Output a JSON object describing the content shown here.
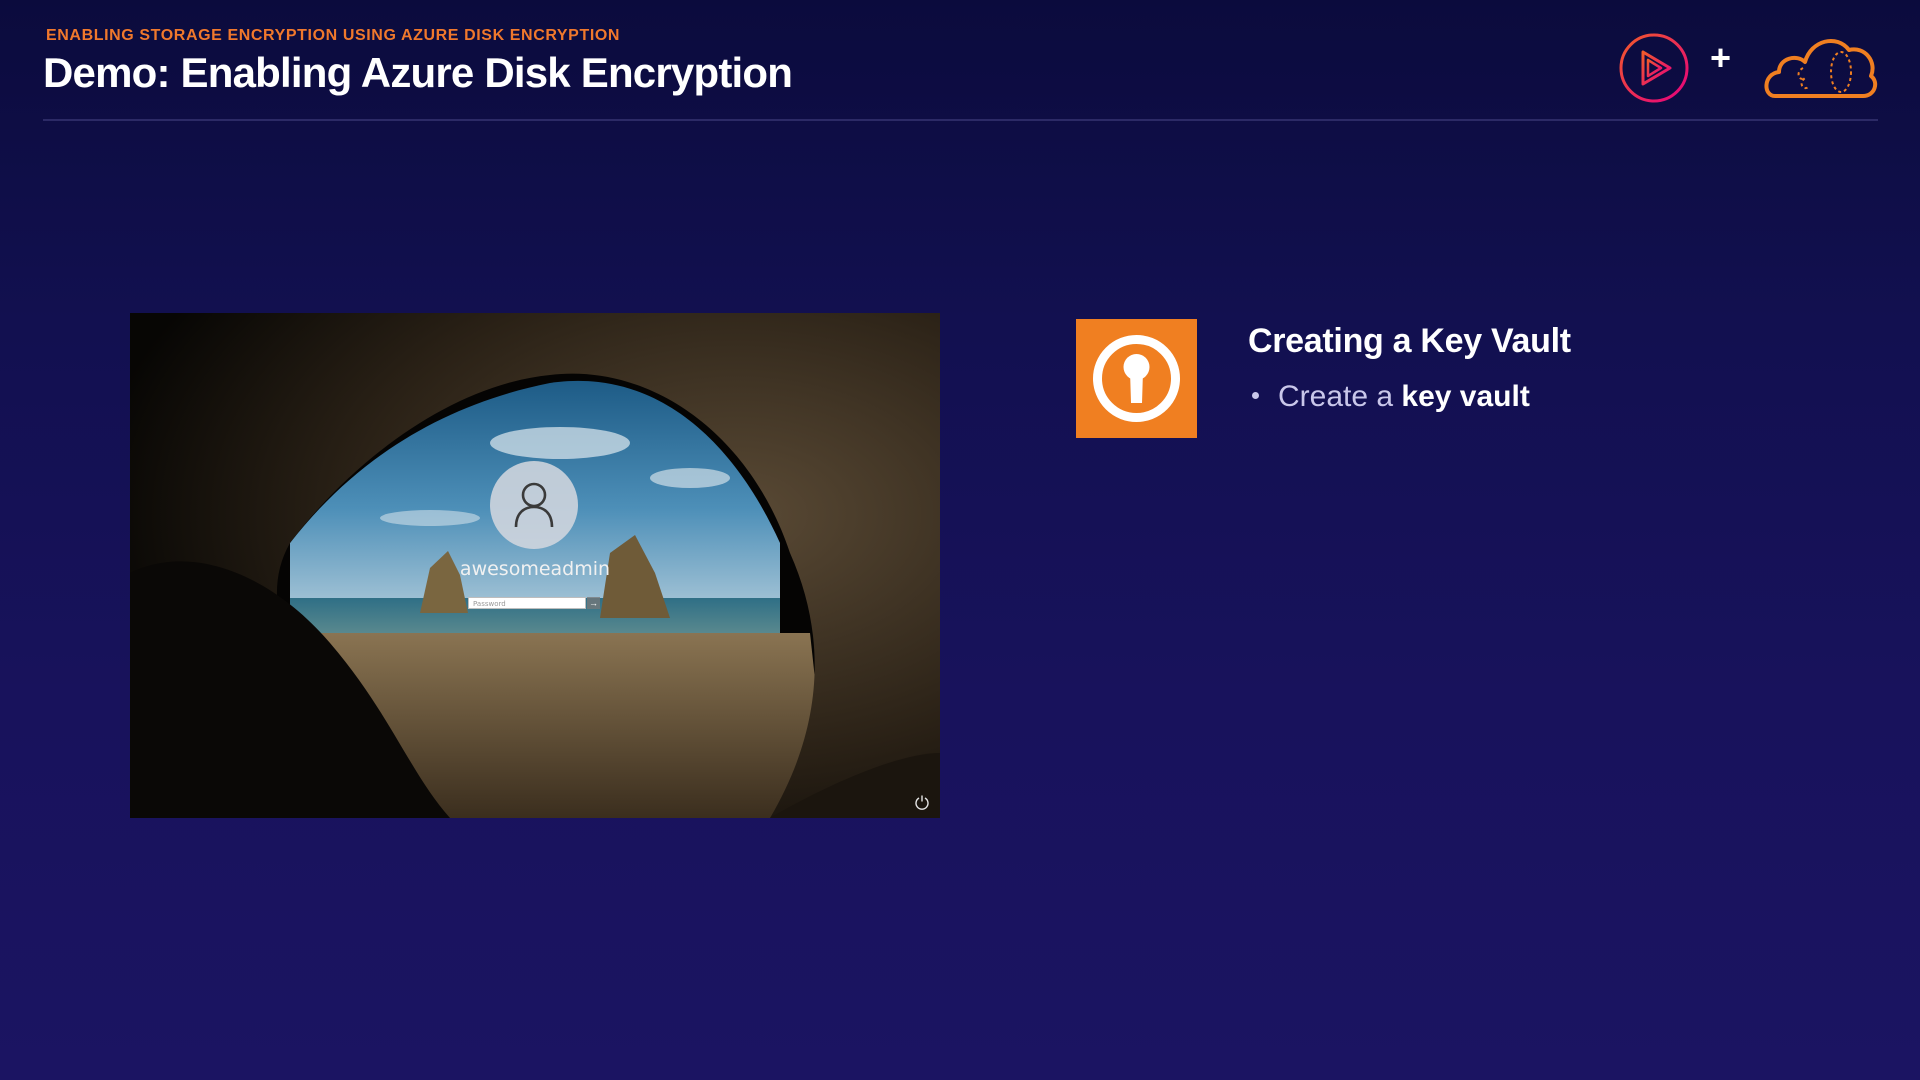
{
  "header": {
    "eyebrow": "ENABLING STORAGE ENCRYPTION USING AZURE DISK ENCRYPTION",
    "title": "Demo: Enabling Azure Disk Encryption",
    "plus": "+",
    "logos": [
      "play-logo",
      "cloud-logo"
    ]
  },
  "screenshot": {
    "username": "awesomeadmin",
    "password_placeholder": "Password",
    "submit_arrow": "→",
    "icons": [
      "user-icon",
      "power-icon"
    ]
  },
  "content": {
    "icon": "key-vault-icon",
    "heading": "Creating a Key Vault",
    "bullets": [
      {
        "prefix": "Create a ",
        "bold": "key vault"
      }
    ]
  },
  "colors": {
    "accent_orange": "#f07f21",
    "eyebrow_orange": "#f0782c",
    "play_gradient_start": "#f15b2a",
    "play_gradient_end": "#e6007e",
    "background_top": "#0b0b3d",
    "background_bottom": "#1b1462"
  }
}
